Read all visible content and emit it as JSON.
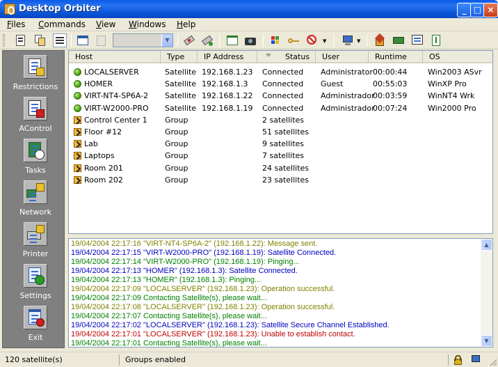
{
  "window": {
    "title": "Desktop Orbiter"
  },
  "menu": [
    "Files",
    "Commands",
    "View",
    "Windows",
    "Help"
  ],
  "toolbar": {
    "combo_value": ""
  },
  "sidebar": [
    {
      "label": "Restrictions",
      "icon": "restrictions-icon"
    },
    {
      "label": "AControl",
      "icon": "acontrol-icon"
    },
    {
      "label": "Tasks",
      "icon": "tasks-icon"
    },
    {
      "label": "Network",
      "icon": "network-icon"
    },
    {
      "label": "Printer",
      "icon": "printer-icon"
    },
    {
      "label": "Settings",
      "icon": "settings-icon"
    },
    {
      "label": "Exit",
      "icon": "exit-icon"
    }
  ],
  "list": {
    "columns": [
      "Host",
      "Type",
      "IP Address",
      "Status",
      "User",
      "Runtime",
      "OS"
    ],
    "rows": [
      {
        "kind": "satellite",
        "host": "LOCALSERVER",
        "type": "Satellite",
        "ip": "192.168.1.23",
        "status": "Connected",
        "user": "Administrator",
        "runtime": "00:00:44",
        "os": "Win2003 ASvr"
      },
      {
        "kind": "satellite",
        "host": "HOMER",
        "type": "Satellite",
        "ip": "192.168.1.3",
        "status": "Connected",
        "user": "Guest",
        "runtime": "00:55:03",
        "os": "WinXP Pro"
      },
      {
        "kind": "satellite",
        "host": "VIRT-NT4-SP6A-2",
        "type": "Satellite",
        "ip": "192.168.1.22",
        "status": "Connected",
        "user": "Administrador",
        "runtime": "00:03:59",
        "os": "WinNT4 Wrk"
      },
      {
        "kind": "satellite",
        "host": "VIRT-W2000-PRO",
        "type": "Satellite",
        "ip": "192.168.1.19",
        "status": "Connected",
        "user": "Administrador",
        "runtime": "00:07:24",
        "os": "Win2000 Pro"
      },
      {
        "kind": "group",
        "host": "Control Center 1",
        "type": "Group",
        "ip": "",
        "status": "2 satellites",
        "user": "",
        "runtime": "",
        "os": ""
      },
      {
        "kind": "group",
        "host": "Floor #12",
        "type": "Group",
        "ip": "",
        "status": "51 satellites",
        "user": "",
        "runtime": "",
        "os": ""
      },
      {
        "kind": "group",
        "host": "Lab",
        "type": "Group",
        "ip": "",
        "status": "9 satellites",
        "user": "",
        "runtime": "",
        "os": ""
      },
      {
        "kind": "group",
        "host": "Laptops",
        "type": "Group",
        "ip": "",
        "status": "7 satellites",
        "user": "",
        "runtime": "",
        "os": ""
      },
      {
        "kind": "group",
        "host": "Room 201",
        "type": "Group",
        "ip": "",
        "status": "24 satellites",
        "user": "",
        "runtime": "",
        "os": ""
      },
      {
        "kind": "group",
        "host": "Room 202",
        "type": "Group",
        "ip": "",
        "status": "23 satellites",
        "user": "",
        "runtime": "",
        "os": ""
      }
    ]
  },
  "log": [
    {
      "text": "19/04/2004 22:17:16  \"VIRT-NT4-SP6A-2\" (192.168.1.22): Message sent.",
      "color": "#808000"
    },
    {
      "text": "19/04/2004 22:17:15  \"VIRT-W2000-PRO\" (192.168.1.19): Satellite Connected.",
      "color": "#0000c0"
    },
    {
      "text": "19/04/2004 22:17:14  \"VIRT-W2000-PRO\" (192.168.1.19): Pinging...",
      "color": "#008000"
    },
    {
      "text": "19/04/2004 22:17:13  \"HOMER\" (192.168.1.3): Satellite Connected.",
      "color": "#0000c0"
    },
    {
      "text": "19/04/2004 22:17:13  \"HOMER\" (192.168.1.3): Pinging...",
      "color": "#008000"
    },
    {
      "text": "19/04/2004 22:17:09  \"LOCALSERVER\" (192.168.1.23): Operation successful.",
      "color": "#808000"
    },
    {
      "text": "19/04/2004 22:17:09  Contacting Satellite(s), please wait...",
      "color": "#008000"
    },
    {
      "text": "19/04/2004 22:17:08  \"LOCALSERVER\" (192.168.1.23): Operation successful.",
      "color": "#808000"
    },
    {
      "text": "19/04/2004 22:17:07  Contacting Satellite(s), please wait...",
      "color": "#008000"
    },
    {
      "text": "19/04/2004 22:17:02  \"LOCALSERVER\" (192.168.1.23): Satellite Secure Channel Established.",
      "color": "#0000c0"
    },
    {
      "text": "19/04/2004 22:17:01  \"LOCALSERVER\" (192.168.1.23): Unable to establish contact.",
      "color": "#c00000"
    },
    {
      "text": "19/04/2004 22:17:01  Contacting Satellite(s), please wait...",
      "color": "#008000"
    }
  ],
  "status": {
    "count": "120 satellite(s)",
    "groups": "Groups enabled"
  }
}
